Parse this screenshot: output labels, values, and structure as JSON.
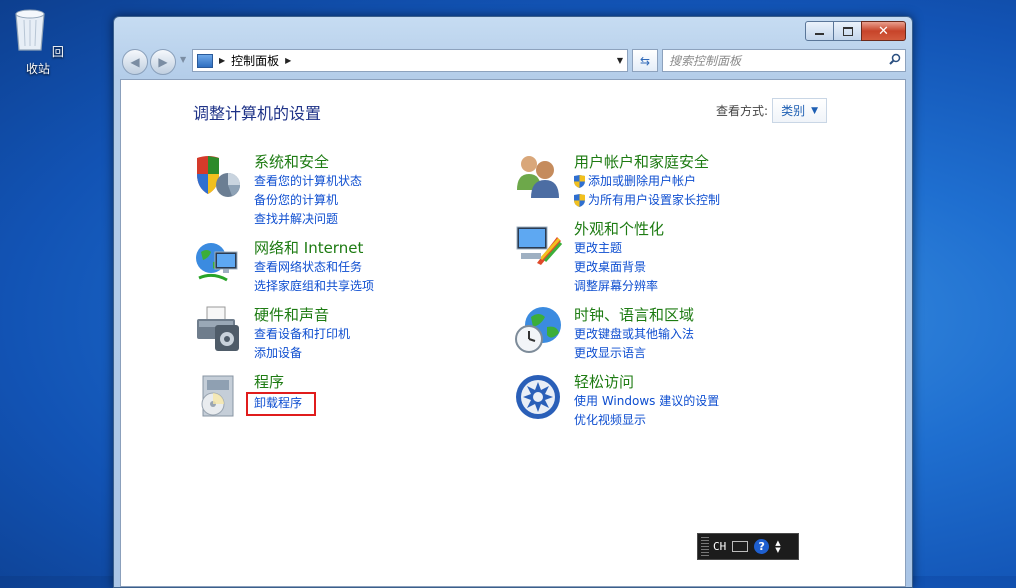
{
  "desktop": {
    "recycle_label": "回收站"
  },
  "window": {
    "address": {
      "crumb": "控制面板"
    },
    "search": {
      "placeholder": "搜索控制面板"
    }
  },
  "content": {
    "title": "调整计算机的设置",
    "view_by": {
      "label": "查看方式:",
      "value": "类别"
    },
    "categories": [
      {
        "title": "系统和安全",
        "links": [
          "查看您的计算机状态",
          "备份您的计算机",
          "查找并解决问题"
        ]
      },
      {
        "title": "网络和 Internet",
        "links": [
          "查看网络状态和任务",
          "选择家庭组和共享选项"
        ]
      },
      {
        "title": "硬件和声音",
        "links": [
          "查看设备和打印机",
          "添加设备"
        ]
      },
      {
        "title": "程序",
        "links": [
          "卸载程序"
        ]
      },
      {
        "title": "用户帐户和家庭安全",
        "links": [
          "添加或删除用户帐户",
          "为所有用户设置家长控制"
        ]
      },
      {
        "title": "外观和个性化",
        "links": [
          "更改主题",
          "更改桌面背景",
          "调整屏幕分辨率"
        ]
      },
      {
        "title": "时钟、语言和区域",
        "links": [
          "更改键盘或其他输入法",
          "更改显示语言"
        ]
      },
      {
        "title": "轻松访问",
        "links": [
          "使用 Windows 建议的设置",
          "优化视频显示"
        ]
      }
    ]
  },
  "ime": {
    "mode": "CH"
  }
}
